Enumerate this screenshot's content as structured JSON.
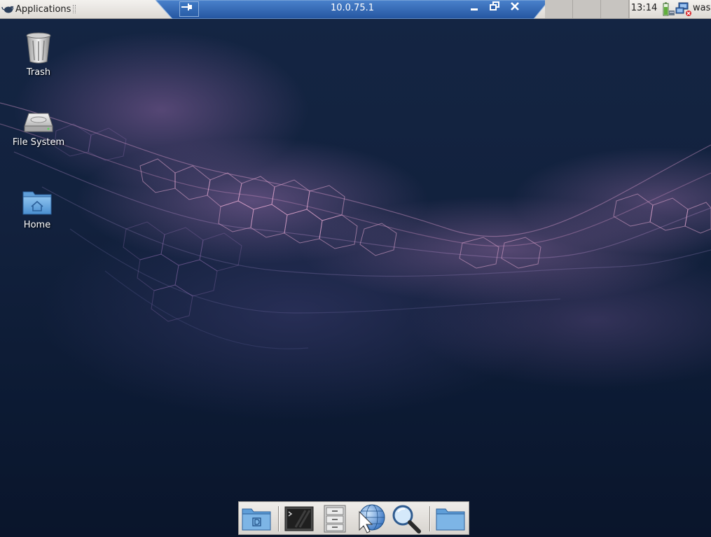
{
  "top_panel": {
    "applications_label": "Applications",
    "window_title": "10.0.75.1",
    "clock": "13:14",
    "user_label": "was"
  },
  "desktop": {
    "icons": [
      {
        "label": "Trash",
        "icon": "trash-icon"
      },
      {
        "label": "File System",
        "icon": "hard-drive-icon"
      },
      {
        "label": "Home",
        "icon": "home-folder-icon"
      }
    ]
  },
  "dock": {
    "items": [
      {
        "icon": "desktop-folder-icon"
      },
      {
        "icon": "terminal-icon"
      },
      {
        "icon": "file-cabinet-icon"
      },
      {
        "icon": "web-browser-icon"
      },
      {
        "icon": "search-icon"
      },
      {
        "icon": "folder-icon"
      }
    ]
  },
  "colors": {
    "panel": "#e8e5e1",
    "window_tab": "#2f62ad",
    "desktop": "#0c1a33"
  }
}
